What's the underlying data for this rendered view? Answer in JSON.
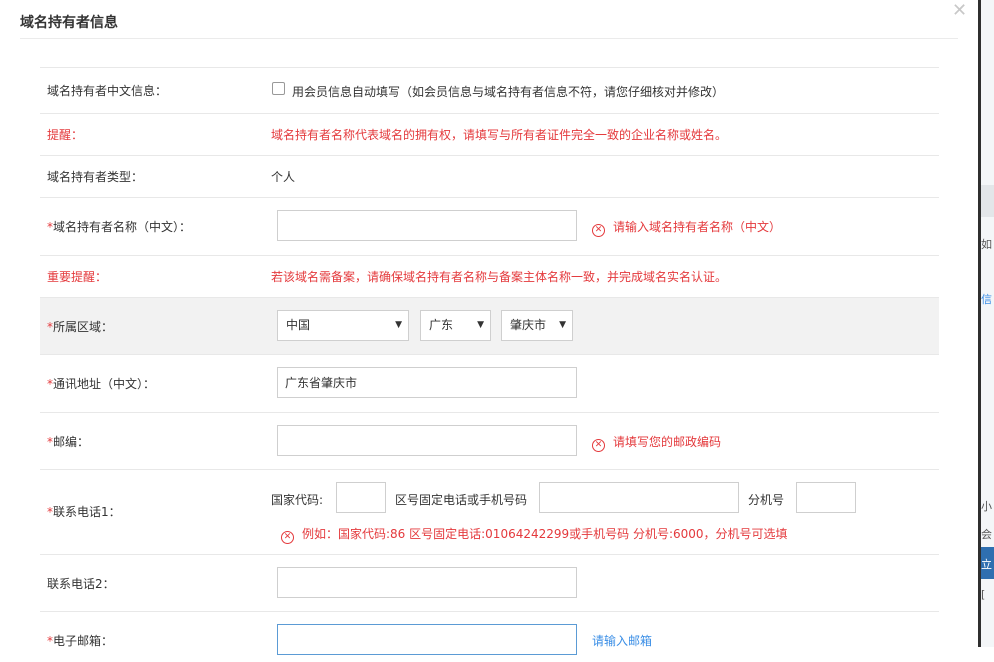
{
  "dialog": {
    "title": "域名持有者信息"
  },
  "form": {
    "chinese_info": {
      "label": "域名持有者中文信息：",
      "checkbox_text": "用会员信息自动填写（如会员信息与域名持有者信息不符，请您仔细核对并修改）"
    },
    "reminder": {
      "label": "提醒：",
      "text": "域名持有者名称代表域名的拥有权，请填写与所有者证件完全一致的企业名称或姓名。"
    },
    "holder_type": {
      "label": "域名持有者类型：",
      "value": "个人"
    },
    "holder_name": {
      "required_mark": "*",
      "label": "域名持有者名称（中文）：",
      "value": "",
      "error": "请输入域名持有者名称（中文）"
    },
    "important_reminder": {
      "label": "重要提醒：",
      "text": "若该域名需备案，请确保域名持有者名称与备案主体名称一致，并完成域名实名认证。"
    },
    "region": {
      "required_mark": "*",
      "label": "所属区域：",
      "country": "中国",
      "province": "广东",
      "city": "肇庆市"
    },
    "address": {
      "required_mark": "*",
      "label": "通讯地址（中文）：",
      "value": "广东省肇庆市"
    },
    "postcode": {
      "required_mark": "*",
      "label": "邮编：",
      "value": "",
      "error": "请填写您的邮政编码"
    },
    "phone1": {
      "required_mark": "*",
      "label": "联系电话1：",
      "country_code_label": "国家代码:",
      "country_code": "",
      "number_label": "区号固定电话或手机号码",
      "number": "",
      "ext_label": "分机号",
      "ext": "",
      "error": "例如：国家代码:86 区号固定电话:01064242299或手机号码 分机号:6000，分机号可选填"
    },
    "phone2": {
      "label": "联系电话2：",
      "value": ""
    },
    "email": {
      "required_mark": "*",
      "label": "电子邮箱：",
      "value": "",
      "hint": "请输入邮箱"
    }
  },
  "background_fragments": [
    "如",
    "信",
    "小",
    "会",
    "立",
    "["
  ],
  "colors": {
    "error": "#e4393c",
    "link": "#3a8ee6",
    "border": "#cfcfcf"
  }
}
